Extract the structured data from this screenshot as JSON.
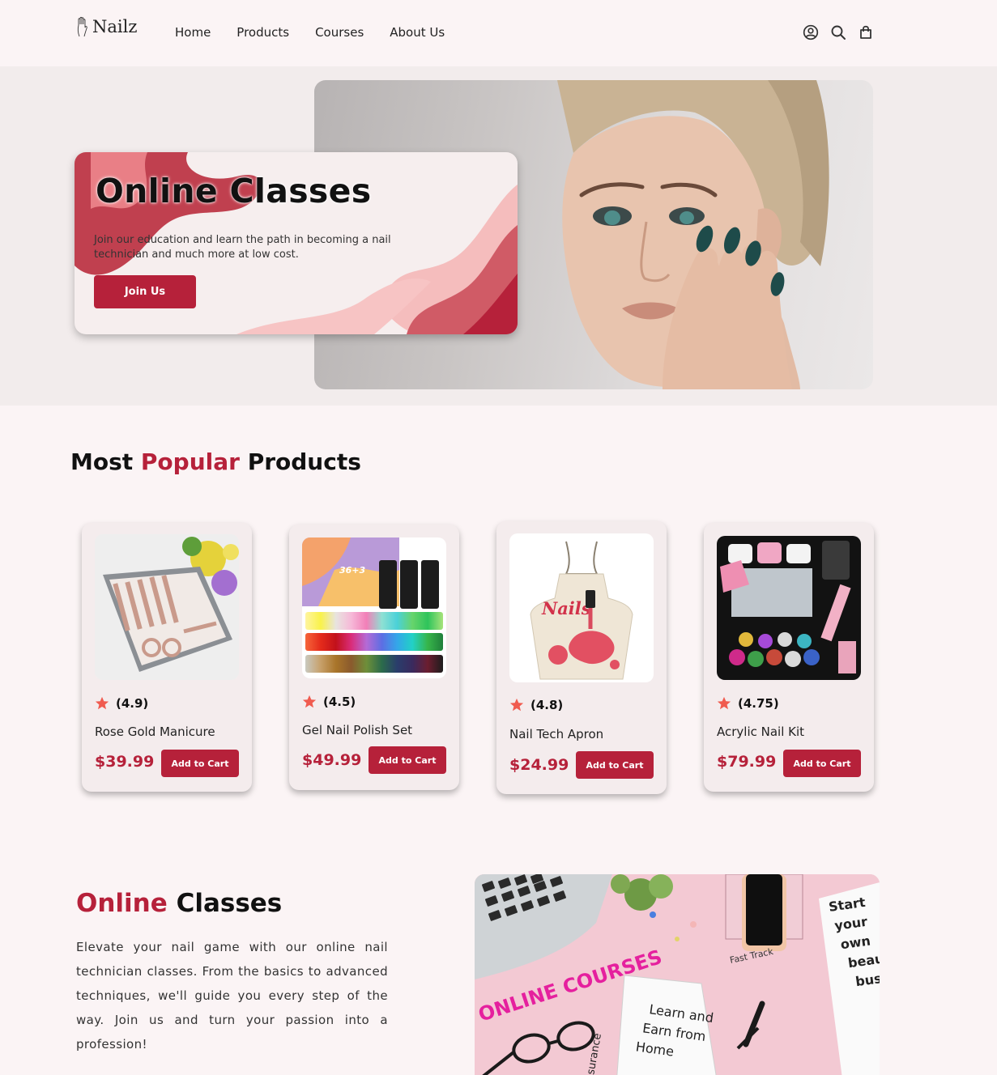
{
  "header": {
    "logo_text": "Nailz",
    "nav": [
      "Home",
      "Products",
      "Courses",
      "About Us"
    ],
    "icons": [
      "user-icon",
      "search-icon",
      "cart-icon"
    ]
  },
  "hero": {
    "title": "Online Classes",
    "text": "Join our education and learn the path in becoming a nail technician and much more at low cost.",
    "button": "Join Us"
  },
  "popular": {
    "title_pre": "Most ",
    "title_accent": "Popular",
    "title_post": " Products"
  },
  "products": [
    {
      "rating": "(4.9)",
      "name": "Rose Gold Manicure",
      "price": "$39.99",
      "button": "Add to Cart"
    },
    {
      "rating": "(4.5)",
      "name": "Gel Nail Polish Set",
      "price": "$49.99",
      "button": "Add to Cart",
      "box_label": "36+3"
    },
    {
      "rating": "(4.8)",
      "name": "Nail Tech Apron",
      "price": "$24.99",
      "button": "Add to Cart",
      "apron_label": "Nails"
    },
    {
      "rating": "(4.75)",
      "name": "Acrylic Nail Kit",
      "price": "$79.99",
      "button": "Add to Cart"
    }
  ],
  "online_classes": {
    "title_accent": "Online",
    "title_rest": " Classes",
    "text": "Elevate your nail game with our online nail technician classes. From the basics to advanced techniques, we'll guide you every step of the way. Join us and turn your passion into a profession!",
    "photo_banner": "ONLINE COURSES",
    "photo_notebook": "Learn and Earn from Home",
    "photo_card": "Start your own beauty busine",
    "photo_fast": "Fast Track",
    "photo_insurance": "Insurance"
  },
  "colors": {
    "accent": "#b6213a",
    "background": "#fbf4f5",
    "hero_bg": "#f2ecec",
    "star": "#f05b4f"
  }
}
